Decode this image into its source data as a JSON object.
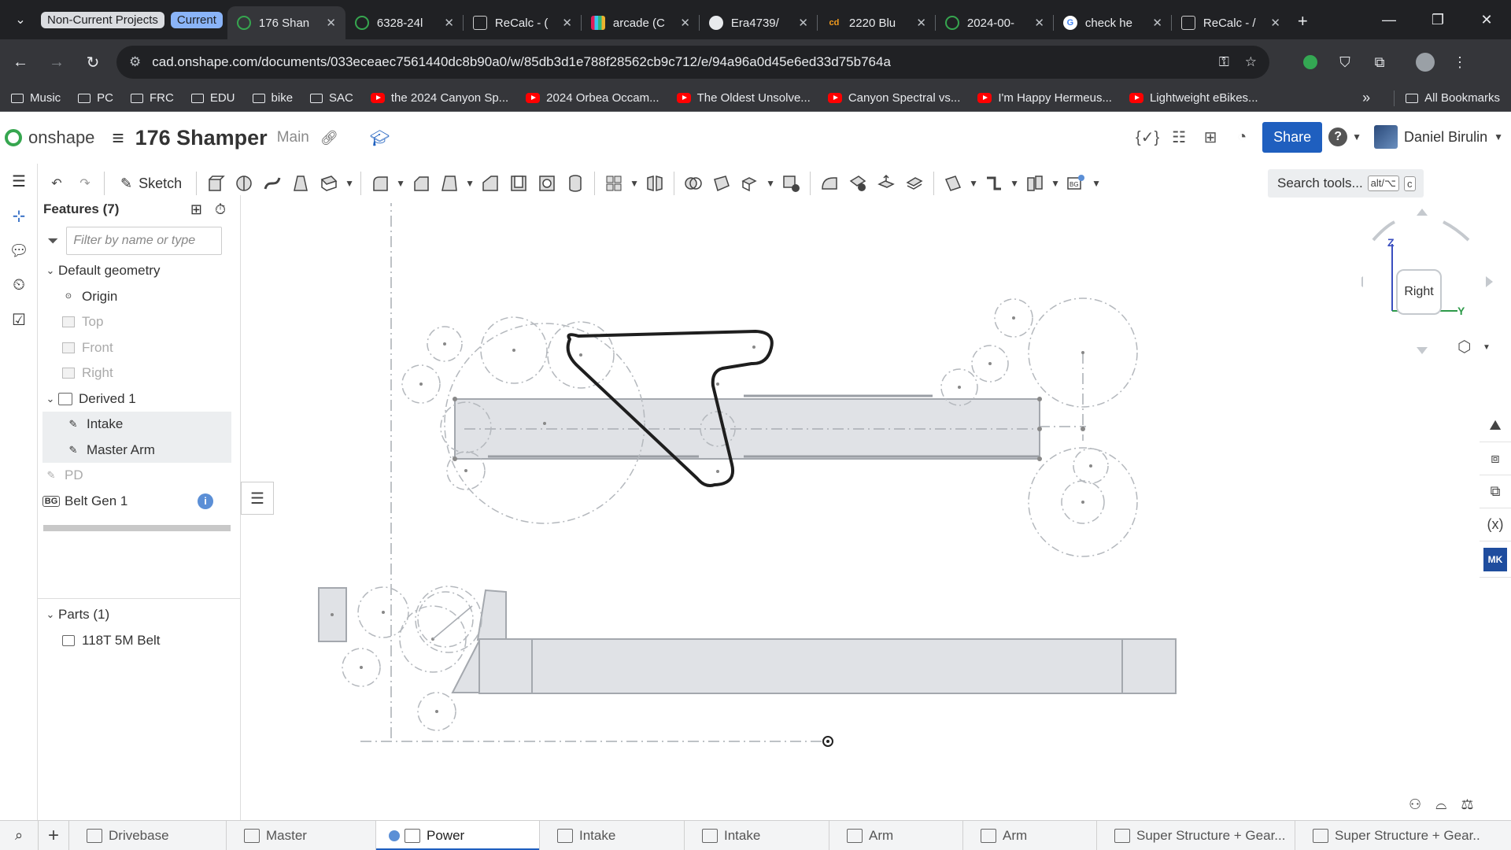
{
  "browser": {
    "tab_groups": [
      "Non-Current Projects",
      "Current"
    ],
    "tabs": [
      {
        "title": "176 Shan",
        "icon": "onshape-icon",
        "active": true
      },
      {
        "title": "6328-24l",
        "icon": "onshape-icon"
      },
      {
        "title": "ReCalc - (",
        "icon": "recalc-icon"
      },
      {
        "title": "arcade (C",
        "icon": "slack-icon"
      },
      {
        "title": "Era4739/",
        "icon": "github-icon"
      },
      {
        "title": "2220 Blu",
        "icon": "cd-icon"
      },
      {
        "title": "2024-00-",
        "icon": "onshape-icon"
      },
      {
        "title": "check he",
        "icon": "google-icon"
      },
      {
        "title": "ReCalc - /",
        "icon": "recalc-icon"
      }
    ],
    "url": "cad.onshape.com/documents/033eceaec7561440dc8b90a0/w/85db3d1e788f28562cb9c712/e/94a96a0d45e6ed33d75b764a",
    "bookmarks": [
      {
        "label": "Music",
        "type": "folder"
      },
      {
        "label": "PC",
        "type": "folder"
      },
      {
        "label": "FRC",
        "type": "folder"
      },
      {
        "label": "EDU",
        "type": "folder"
      },
      {
        "label": "bike",
        "type": "folder"
      },
      {
        "label": "SAC",
        "type": "folder"
      },
      {
        "label": "the 2024 Canyon Sp...",
        "type": "youtube"
      },
      {
        "label": "2024 Orbea Occam...",
        "type": "youtube"
      },
      {
        "label": "The Oldest Unsolve...",
        "type": "youtube"
      },
      {
        "label": "Canyon Spectral vs...",
        "type": "youtube"
      },
      {
        "label": "I'm Happy Hermeus...",
        "type": "youtube"
      },
      {
        "label": "Lightweight eBikes...",
        "type": "youtube"
      }
    ],
    "bookmarks_more": "»",
    "all_bookmarks": "All Bookmarks"
  },
  "onshape": {
    "logo_text": "onshape",
    "document_name": "176 Shamper",
    "branch": "Main",
    "share_label": "Share",
    "help_label": "?",
    "user_name": "Daniel Birulin"
  },
  "toolbar": {
    "sketch_label": "Sketch",
    "search_placeholder": "Search tools...",
    "search_shortcut_1": "alt/⌥",
    "search_shortcut_2": "c"
  },
  "feature_panel": {
    "title": "Features (7)",
    "filter_placeholder": "Filter by name or type",
    "items": [
      {
        "label": "Default geometry",
        "level": 0,
        "caret": "expanded"
      },
      {
        "label": "Origin",
        "level": 1
      },
      {
        "label": "Top",
        "level": 1,
        "dim": true
      },
      {
        "label": "Front",
        "level": 1,
        "dim": true
      },
      {
        "label": "Right",
        "level": 1,
        "dim": true
      },
      {
        "label": "Derived 1",
        "level": 0,
        "caret": "expanded"
      },
      {
        "label": "Intake",
        "level": 1,
        "selected": true
      },
      {
        "label": "Master Arm",
        "level": 1,
        "selected": true
      },
      {
        "label": "PD",
        "level": 0,
        "dim": true
      },
      {
        "label": "Belt Gen 1",
        "level": 0,
        "badge": "BG"
      }
    ],
    "parts_title": "Parts (1)",
    "parts": [
      "118T 5M Belt"
    ]
  },
  "viewcube": {
    "face": "Right",
    "axis_z": "Z",
    "axis_y": "Y"
  },
  "bottom_tabs": [
    {
      "label": "Drivebase"
    },
    {
      "label": "Master"
    },
    {
      "label": "Power",
      "active": true
    },
    {
      "label": "Intake"
    },
    {
      "label": "Intake"
    },
    {
      "label": "Arm"
    },
    {
      "label": "Arm"
    },
    {
      "label": "Super Structure + Gear..."
    },
    {
      "label": "Super Structure + Gear..."
    }
  ],
  "colors": {
    "accent": "#1f5fbf",
    "onshape_green": "#36a64f",
    "sketch_gray": "#a9adb3"
  }
}
